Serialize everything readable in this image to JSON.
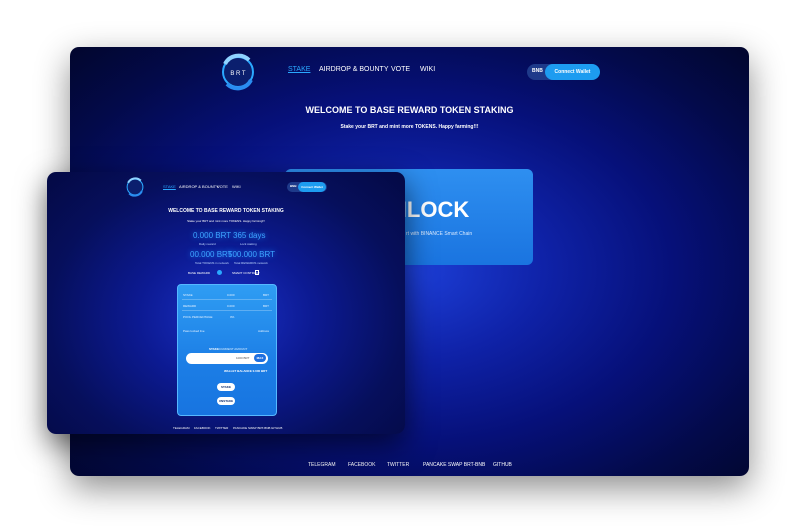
{
  "nav": {
    "stake": "STAKE",
    "airdrop": "AIRDROP & BOUNTY",
    "vote": "VOTE",
    "wiki": "WIKI"
  },
  "wallet": {
    "network": "BNB",
    "connect": "Connect Wallet"
  },
  "hero": {
    "title": "WELCOME TO BASE REWARD TOKEN STAKING",
    "subtitle": "Stake your BRT and mint more TOKENS. Happy farming!!!"
  },
  "back_card": {
    "title": "NLOCK",
    "sub": "rt with BINANCE Smart Chain"
  },
  "stats": {
    "daily_value": "0.000 BRT",
    "daily_label": "Daily reward",
    "days_value": "365 days",
    "days_label": "Lock staking",
    "total_value": "00.000 BRT",
    "total_label": "Total TOKENS in network",
    "max_value": "500.000 BRT",
    "max_label": "Total REWARDS network",
    "reward_token": "BASE REWARD",
    "contract": "SMART CONTRACT"
  },
  "panel": {
    "rows": [
      {
        "label": "STAKE",
        "value": "0.000",
        "unit": "BRT"
      },
      {
        "label": "REWARD",
        "value": "0.000",
        "unit": "BRT"
      },
      {
        "label": "POOL PERCENTAGE",
        "value": "0%",
        "unit": ""
      }
    ],
    "pending_label": "Pass locked live",
    "pending_value": "Address",
    "max_label": "STAKE",
    "max_link": "CURRENT AMOUNT",
    "input_value": "1000 BRT",
    "input_btn": "MAX",
    "wallet_balance": "WALLET BALANCE 0.000 BRT",
    "stake_btn": "STAKE",
    "unstake_btn": "UNSTAKE"
  },
  "footer": {
    "links": [
      "TELEGRAM",
      "FACEBOOK",
      "TWITTER",
      "PANCAKE SWAP BRT-BNB",
      "GITHUB"
    ]
  },
  "colors": {
    "accent": "#1d9cf0",
    "active_nav": "#2aa8ff",
    "bg_deep": "#030a4a"
  }
}
